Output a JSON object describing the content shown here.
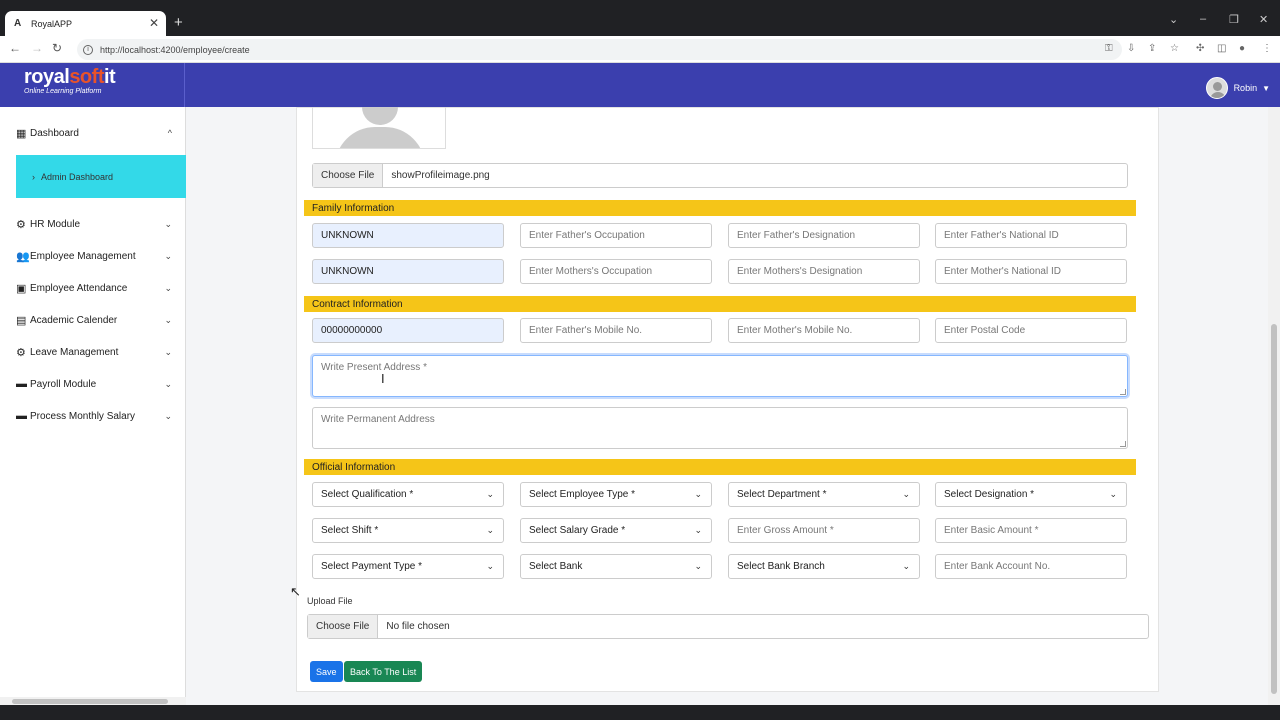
{
  "browser": {
    "tab_title": "RoyalAPP",
    "url": "http://localhost:4200/employee/create",
    "new_tab": "+",
    "tab_close": "✕"
  },
  "header": {
    "logo_royal": "royal",
    "logo_soft": "soft",
    "logo_it": "it",
    "logo_sub": "Online Learning Platform",
    "user_name": "Robin"
  },
  "sidebar": {
    "items": [
      {
        "label": "Dashboard",
        "icon": "dashboard-icon",
        "chev": "^"
      },
      {
        "label": "Admin Dashboard"
      },
      {
        "label": "HR Module",
        "icon": "hr-icon",
        "chev": "⌄"
      },
      {
        "label": "Employee Management",
        "icon": "users-icon",
        "chev": "⌄"
      },
      {
        "label": "Employee Attendance",
        "icon": "calendar-check-icon",
        "chev": "⌄"
      },
      {
        "label": "Academic Calender",
        "icon": "calendar-icon",
        "chev": "⌄"
      },
      {
        "label": "Leave Management",
        "icon": "gear-icon",
        "chev": "⌄"
      },
      {
        "label": "Payroll Module",
        "icon": "money-icon",
        "chev": "⌄"
      },
      {
        "label": "Process Monthly Salary",
        "icon": "money-icon",
        "chev": "⌄"
      }
    ]
  },
  "form": {
    "photo_file_button": "Choose File",
    "photo_file_name": "showProfileimage.png",
    "family_title": "Family Information",
    "family": {
      "father_name": "UNKNOWN",
      "father_occupation": "Enter Father's Occupation",
      "father_designation": "Enter Father's Designation",
      "father_nid": "Enter Father's National ID",
      "mother_name": "UNKNOWN",
      "mother_occupation": "Enter Mothers's Occupation",
      "mother_designation": "Enter Mothers's Designation",
      "mother_nid": "Enter Mother's National ID"
    },
    "contract_title": "Contract Information",
    "contract": {
      "mobile": "00000000000",
      "father_mobile": "Enter Father's Mobile No.",
      "mother_mobile": "Enter Mother's Mobile No.",
      "postal_code": "Enter Postal Code",
      "present_address": "Write Present Address *",
      "permanent_address": "Write Permanent Address"
    },
    "official_title": "Official Information",
    "official": {
      "qualification": "Select Qualification *",
      "employee_type": "Select Employee Type *",
      "department": "Select Department *",
      "designation": "Select Designation *",
      "shift": "Select Shift *",
      "salary_grade": "Select Salary Grade *",
      "gross_amount": "Enter Gross Amount *",
      "basic_amount": "Enter Basic Amount *",
      "payment_type": "Select Payment Type *",
      "bank": "Select Bank",
      "bank_branch": "Select Bank Branch",
      "bank_account": "Enter Bank Account No."
    },
    "upload_label": "Upload File",
    "upload_button": "Choose File",
    "upload_file_name": "No file chosen",
    "save_label": "Save",
    "back_label": "Back To The List"
  }
}
